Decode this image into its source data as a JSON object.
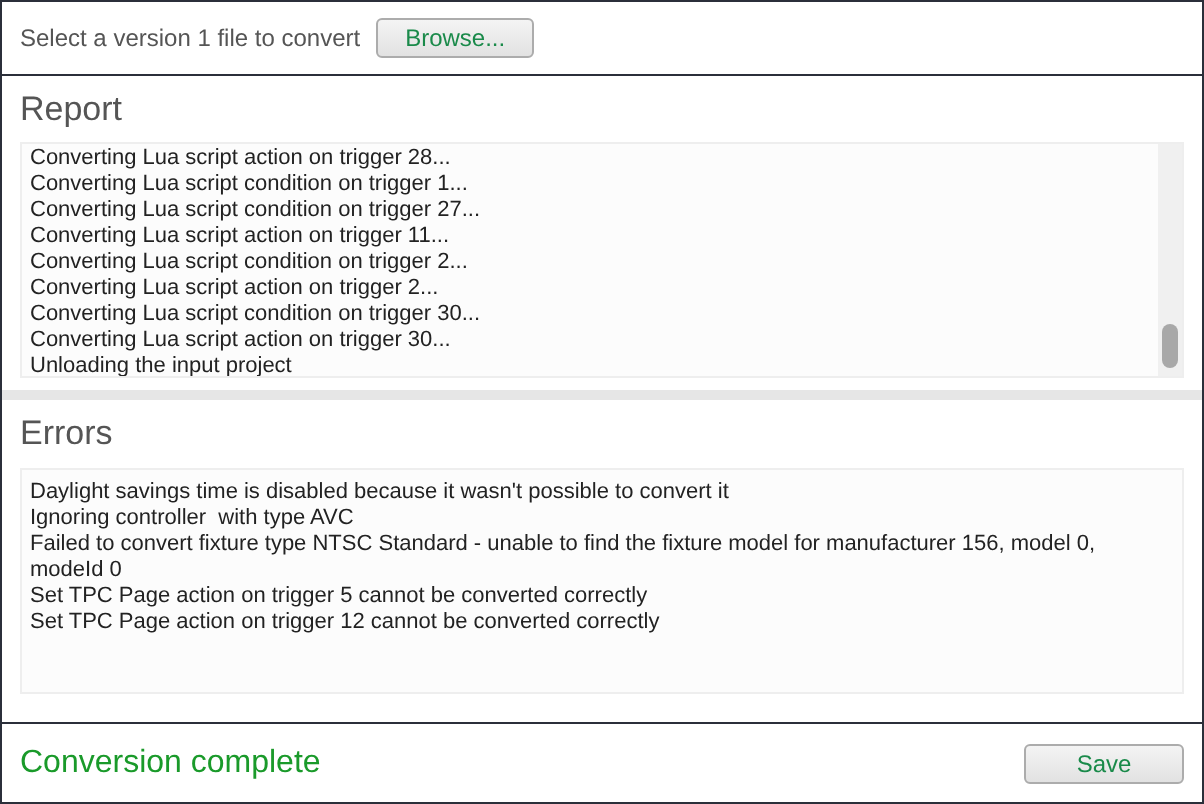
{
  "file_picker": {
    "label": "Select a version 1 file to convert",
    "button": "Browse..."
  },
  "report": {
    "title": "Report",
    "lines": [
      "Converting Lua script action on trigger 28...",
      "Converting Lua script condition on trigger 1...",
      "Converting Lua script condition on trigger 27...",
      "Converting Lua script action on trigger 11...",
      "Converting Lua script condition on trigger 2...",
      "Converting Lua script action on trigger 2...",
      "Converting Lua script condition on trigger 30...",
      "Converting Lua script action on trigger 30...",
      "Unloading the input project"
    ]
  },
  "errors": {
    "title": "Errors",
    "lines": [
      "Daylight savings time is disabled because it wasn't possible to convert it",
      "Ignoring controller  with type AVC",
      "Failed to convert fixture type NTSC Standard - unable to find the fixture model for manufacturer 156, model 0, modeId 0",
      "Set TPC Page action on trigger 5 cannot be converted correctly",
      "Set TPC Page action on trigger 12 cannot be converted correctly"
    ]
  },
  "footer": {
    "status": "Conversion complete",
    "button": "Save"
  }
}
